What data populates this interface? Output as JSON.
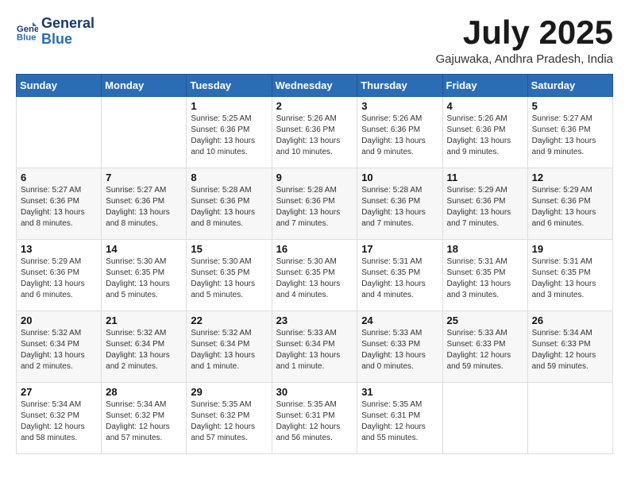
{
  "logo": {
    "line1": "General",
    "line2": "Blue"
  },
  "title": "July 2025",
  "location": "Gajuwaka, Andhra Pradesh, India",
  "weekdays": [
    "Sunday",
    "Monday",
    "Tuesday",
    "Wednesday",
    "Thursday",
    "Friday",
    "Saturday"
  ],
  "weeks": [
    [
      {
        "day": "",
        "info": ""
      },
      {
        "day": "",
        "info": ""
      },
      {
        "day": "1",
        "info": "Sunrise: 5:25 AM\nSunset: 6:36 PM\nDaylight: 13 hours and 10 minutes."
      },
      {
        "day": "2",
        "info": "Sunrise: 5:26 AM\nSunset: 6:36 PM\nDaylight: 13 hours and 10 minutes."
      },
      {
        "day": "3",
        "info": "Sunrise: 5:26 AM\nSunset: 6:36 PM\nDaylight: 13 hours and 9 minutes."
      },
      {
        "day": "4",
        "info": "Sunrise: 5:26 AM\nSunset: 6:36 PM\nDaylight: 13 hours and 9 minutes."
      },
      {
        "day": "5",
        "info": "Sunrise: 5:27 AM\nSunset: 6:36 PM\nDaylight: 13 hours and 9 minutes."
      }
    ],
    [
      {
        "day": "6",
        "info": "Sunrise: 5:27 AM\nSunset: 6:36 PM\nDaylight: 13 hours and 8 minutes."
      },
      {
        "day": "7",
        "info": "Sunrise: 5:27 AM\nSunset: 6:36 PM\nDaylight: 13 hours and 8 minutes."
      },
      {
        "day": "8",
        "info": "Sunrise: 5:28 AM\nSunset: 6:36 PM\nDaylight: 13 hours and 8 minutes."
      },
      {
        "day": "9",
        "info": "Sunrise: 5:28 AM\nSunset: 6:36 PM\nDaylight: 13 hours and 7 minutes."
      },
      {
        "day": "10",
        "info": "Sunrise: 5:28 AM\nSunset: 6:36 PM\nDaylight: 13 hours and 7 minutes."
      },
      {
        "day": "11",
        "info": "Sunrise: 5:29 AM\nSunset: 6:36 PM\nDaylight: 13 hours and 7 minutes."
      },
      {
        "day": "12",
        "info": "Sunrise: 5:29 AM\nSunset: 6:36 PM\nDaylight: 13 hours and 6 minutes."
      }
    ],
    [
      {
        "day": "13",
        "info": "Sunrise: 5:29 AM\nSunset: 6:36 PM\nDaylight: 13 hours and 6 minutes."
      },
      {
        "day": "14",
        "info": "Sunrise: 5:30 AM\nSunset: 6:35 PM\nDaylight: 13 hours and 5 minutes."
      },
      {
        "day": "15",
        "info": "Sunrise: 5:30 AM\nSunset: 6:35 PM\nDaylight: 13 hours and 5 minutes."
      },
      {
        "day": "16",
        "info": "Sunrise: 5:30 AM\nSunset: 6:35 PM\nDaylight: 13 hours and 4 minutes."
      },
      {
        "day": "17",
        "info": "Sunrise: 5:31 AM\nSunset: 6:35 PM\nDaylight: 13 hours and 4 minutes."
      },
      {
        "day": "18",
        "info": "Sunrise: 5:31 AM\nSunset: 6:35 PM\nDaylight: 13 hours and 3 minutes."
      },
      {
        "day": "19",
        "info": "Sunrise: 5:31 AM\nSunset: 6:35 PM\nDaylight: 13 hours and 3 minutes."
      }
    ],
    [
      {
        "day": "20",
        "info": "Sunrise: 5:32 AM\nSunset: 6:34 PM\nDaylight: 13 hours and 2 minutes."
      },
      {
        "day": "21",
        "info": "Sunrise: 5:32 AM\nSunset: 6:34 PM\nDaylight: 13 hours and 2 minutes."
      },
      {
        "day": "22",
        "info": "Sunrise: 5:32 AM\nSunset: 6:34 PM\nDaylight: 13 hours and 1 minute."
      },
      {
        "day": "23",
        "info": "Sunrise: 5:33 AM\nSunset: 6:34 PM\nDaylight: 13 hours and 1 minute."
      },
      {
        "day": "24",
        "info": "Sunrise: 5:33 AM\nSunset: 6:33 PM\nDaylight: 13 hours and 0 minutes."
      },
      {
        "day": "25",
        "info": "Sunrise: 5:33 AM\nSunset: 6:33 PM\nDaylight: 12 hours and 59 minutes."
      },
      {
        "day": "26",
        "info": "Sunrise: 5:34 AM\nSunset: 6:33 PM\nDaylight: 12 hours and 59 minutes."
      }
    ],
    [
      {
        "day": "27",
        "info": "Sunrise: 5:34 AM\nSunset: 6:32 PM\nDaylight: 12 hours and 58 minutes."
      },
      {
        "day": "28",
        "info": "Sunrise: 5:34 AM\nSunset: 6:32 PM\nDaylight: 12 hours and 57 minutes."
      },
      {
        "day": "29",
        "info": "Sunrise: 5:35 AM\nSunset: 6:32 PM\nDaylight: 12 hours and 57 minutes."
      },
      {
        "day": "30",
        "info": "Sunrise: 5:35 AM\nSunset: 6:31 PM\nDaylight: 12 hours and 56 minutes."
      },
      {
        "day": "31",
        "info": "Sunrise: 5:35 AM\nSunset: 6:31 PM\nDaylight: 12 hours and 55 minutes."
      },
      {
        "day": "",
        "info": ""
      },
      {
        "day": "",
        "info": ""
      }
    ]
  ]
}
